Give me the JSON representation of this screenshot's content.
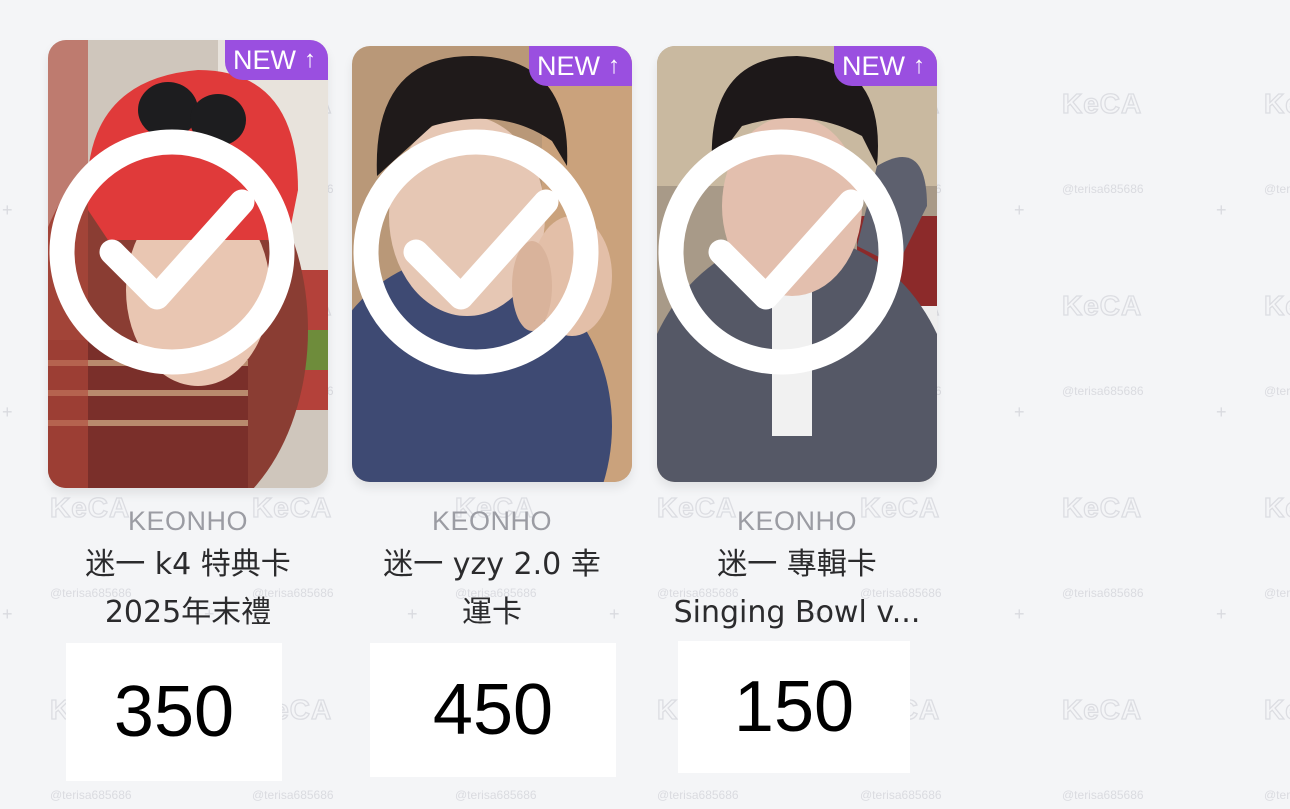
{
  "watermark": {
    "logo_text": "KeCA",
    "handle": "@terisa685686"
  },
  "cards": [
    {
      "badge": {
        "label": "NEW",
        "arrow_icon": "arrow-up-icon"
      },
      "status_icon": "check-circle-icon",
      "owner": "KEONHO",
      "title_line1": "迷一 k4 特典卡",
      "title_line2": "2025年末禮",
      "price": "350"
    },
    {
      "badge": {
        "label": "NEW",
        "arrow_icon": "arrow-up-icon"
      },
      "status_icon": "check-circle-icon",
      "owner": "KEONHO",
      "title_line1": "迷一 yzy 2.0 幸",
      "title_line2": "運卡",
      "price": "450"
    },
    {
      "badge": {
        "label": "NEW",
        "arrow_icon": "arrow-up-icon"
      },
      "status_icon": "check-circle-icon",
      "owner": "KEONHO",
      "title_line1": "迷一 專輯卡",
      "title_line2": "Singing Bowl v...",
      "price": "150"
    }
  ],
  "colors": {
    "background": "#f4f5f7",
    "badge": "#9a4fe0",
    "owner_text": "#9b9ca3",
    "title_text": "#2b2b2d"
  }
}
